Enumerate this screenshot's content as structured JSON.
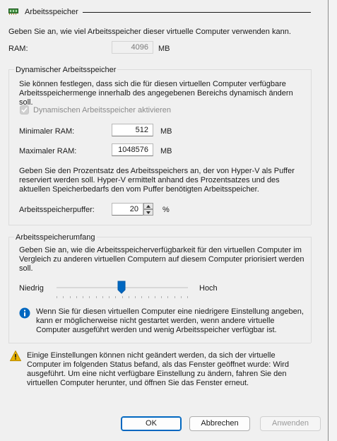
{
  "section": {
    "title": "Arbeitsspeicher",
    "icon": "memory-chip-icon",
    "description": "Geben Sie an, wie viel Arbeitsspeicher dieser virtuelle Computer verwenden kann.",
    "ram_label": "RAM:",
    "ram_value": "4096",
    "ram_unit": "MB"
  },
  "dynamic": {
    "title": "Dynamischer Arbeitsspeicher",
    "description": "Sie können festlegen, dass sich die für diesen virtuellen Computer verfügbare Arbeitsspeichermenge innerhalb des angegebenen Bereichs dynamisch ändern soll.",
    "checkbox_label": "Dynamischen Arbeitsspeicher aktivieren",
    "checkbox_checked": true,
    "min_label": "Minimaler RAM:",
    "min_value": "512",
    "min_unit": "MB",
    "max_label": "Maximaler RAM:",
    "max_value": "1048576",
    "max_unit": "MB",
    "buffer_description": "Geben Sie den Prozentsatz des Arbeitsspeichers an, der von Hyper-V als Puffer reserviert werden soll. Hyper-V ermittelt anhand des Prozentsatzes und des aktuellen Speicherbedarfs den vom Puffer benötigten Arbeitsspeicher.",
    "buffer_label": "Arbeitsspeicherpuffer:",
    "buffer_value": "20",
    "buffer_unit": "%"
  },
  "weight": {
    "title": "Arbeitsspeicherumfang",
    "description": "Geben Sie an, wie die Arbeitsspeicherverfügbarkeit für den virtuellen Computer im Vergleich zu anderen virtuellen Computern auf diesem Computer priorisiert werden soll.",
    "low_label": "Niedrig",
    "high_label": "Hoch",
    "slider_level": 0.5,
    "info_text": "Wenn Sie für diesen virtuellen Computer eine niedrigere Einstellung angeben, kann er möglicherweise nicht gestartet werden, wenn andere virtuelle Computer ausgeführt werden und wenig Arbeitsspeicher verfügbar ist."
  },
  "warning": {
    "text": "Einige Einstellungen können nicht geändert werden, da sich der virtuelle Computer im folgenden Status befand, als das Fenster geöffnet wurde: Wird ausgeführt. Um eine nicht verfügbare Einstellung zu ändern, fahren Sie den virtuellen Computer herunter, und öffnen Sie das Fenster erneut."
  },
  "buttons": {
    "ok": "OK",
    "cancel": "Abbrechen",
    "apply": "Anwenden"
  },
  "colors": {
    "accent": "#0067c0",
    "info": "#0067c0",
    "warning": "#e8b200"
  }
}
